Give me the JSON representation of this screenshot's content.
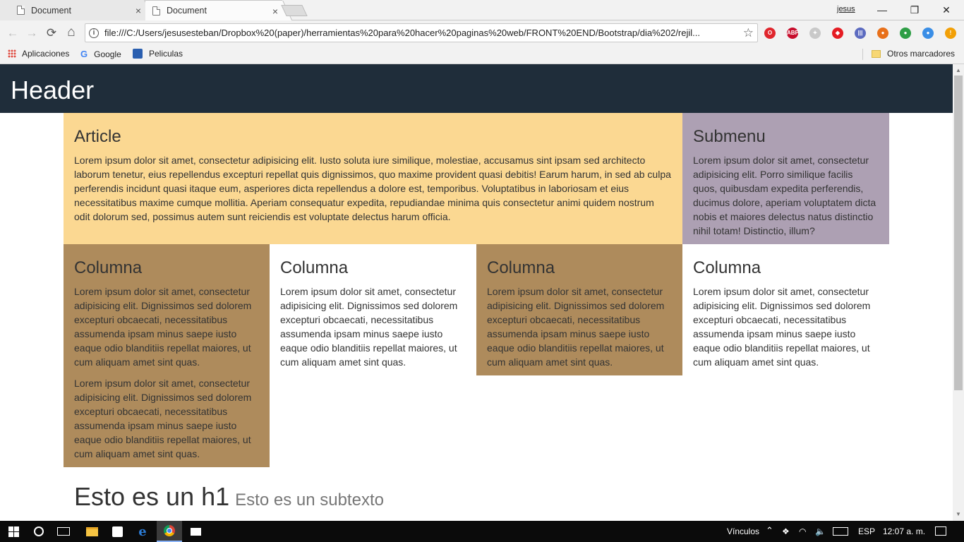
{
  "browser": {
    "tabs": [
      {
        "title": "Document",
        "close": "×"
      },
      {
        "title": "Document",
        "close": "×"
      }
    ],
    "profile": "jesus",
    "window_controls": {
      "minimize": "—",
      "restore": "❐",
      "close": "✕"
    },
    "url": "file:///C:/Users/jesusesteban/Dropbox%20(paper)/herramientas%20para%20hacer%20paginas%20web/FRONT%20END/Bootstrap/dia%202/rejil...",
    "nav": {
      "back": "←",
      "forward": "→",
      "reload": "⟳",
      "home": "⌂",
      "star": "☆",
      "info": "i"
    },
    "extensions": [
      {
        "name": "opera-icon",
        "label": "O",
        "color": "#e0262d"
      },
      {
        "name": "adblock-icon",
        "label": "ABP",
        "color": "#c70d2c"
      },
      {
        "name": "puzzle-icon",
        "label": "✦",
        "color": "#c9c9c9"
      },
      {
        "name": "shield-icon",
        "label": "◆",
        "color": "#e51c23"
      },
      {
        "name": "equalizer-icon",
        "label": "|||",
        "color": "#5c6bc0"
      },
      {
        "name": "firefox-icon",
        "label": "●",
        "color": "#e8701a"
      },
      {
        "name": "globe-icon",
        "label": "●",
        "color": "#2e9e46"
      },
      {
        "name": "chrome-ext-icon",
        "label": "●",
        "color": "#3a8ee6"
      },
      {
        "name": "warning-icon",
        "label": "!",
        "color": "#f2a007"
      }
    ],
    "bookmarks": [
      {
        "label": "Aplicaciones"
      },
      {
        "label": "Google"
      },
      {
        "label": "Peliculas"
      }
    ],
    "other_bookmarks": "Otros marcadores"
  },
  "page": {
    "header": "Header",
    "article": {
      "title": "Article",
      "text": "Lorem ipsum dolor sit amet, consectetur adipisicing elit. Iusto soluta iure similique, molestiae, accusamus sint ipsam sed architecto laborum tenetur, eius repellendus excepturi repellat quis dignissimos, quo maxime provident quasi debitis! Earum harum, in sed ab culpa perferendis incidunt quasi itaque eum, asperiores dicta repellendus a dolore est, temporibus. Voluptatibus in laboriosam et eius necessitatibus maxime cumque mollitia. Aperiam consequatur expedita, repudiandae minima quis consectetur animi quidem nostrum odit dolorum sed, possimus autem sunt reiciendis est voluptate delectus harum officia."
    },
    "submenu": {
      "title": "Submenu",
      "text": "Lorem ipsum dolor sit amet, consectetur adipisicing elit. Porro similique facilis quos, quibusdam expedita perferendis, ducimus dolore, aperiam voluptatem dicta nobis et maiores delectus natus distinctio nihil totam! Distinctio, illum?"
    },
    "columns": [
      {
        "title": "Columna",
        "paragraphs": [
          "Lorem ipsum dolor sit amet, consectetur adipisicing elit. Dignissimos sed dolorem excepturi obcaecati, necessitatibus assumenda ipsam minus saepe iusto eaque odio blanditiis repellat maiores, ut cum aliquam amet sint quas.",
          "Lorem ipsum dolor sit amet, consectetur adipisicing elit. Dignissimos sed dolorem excepturi obcaecati, necessitatibus assumenda ipsam minus saepe iusto eaque odio blanditiis repellat maiores, ut cum aliquam amet sint quas."
        ]
      },
      {
        "title": "Columna",
        "paragraphs": [
          "Lorem ipsum dolor sit amet, consectetur adipisicing elit. Dignissimos sed dolorem excepturi obcaecati, necessitatibus assumenda ipsam minus saepe iusto eaque odio blanditiis repellat maiores, ut cum aliquam amet sint quas."
        ]
      },
      {
        "title": "Columna",
        "paragraphs": [
          "Lorem ipsum dolor sit amet, consectetur adipisicing elit. Dignissimos sed dolorem excepturi obcaecati, necessitatibus assumenda ipsam minus saepe iusto eaque odio blanditiis repellat maiores, ut cum aliquam amet sint quas."
        ]
      },
      {
        "title": "Columna",
        "paragraphs": [
          "Lorem ipsum dolor sit amet, consectetur adipisicing elit. Dignissimos sed dolorem excepturi obcaecati, necessitatibus assumenda ipsam minus saepe iusto eaque odio blanditiis repellat maiores, ut cum aliquam amet sint quas."
        ]
      }
    ],
    "heading": "Esto es un h1",
    "subheading": "Esto es un subtexto"
  },
  "taskbar": {
    "links": "Vínculos",
    "lang": "ESP",
    "time": "12:07 a. m."
  },
  "colors": {
    "header_bg": "#1f2d3a",
    "article_bg": "#fbd892",
    "submenu_bg": "#ada0b3",
    "column_brown": "#ae8b5c"
  }
}
